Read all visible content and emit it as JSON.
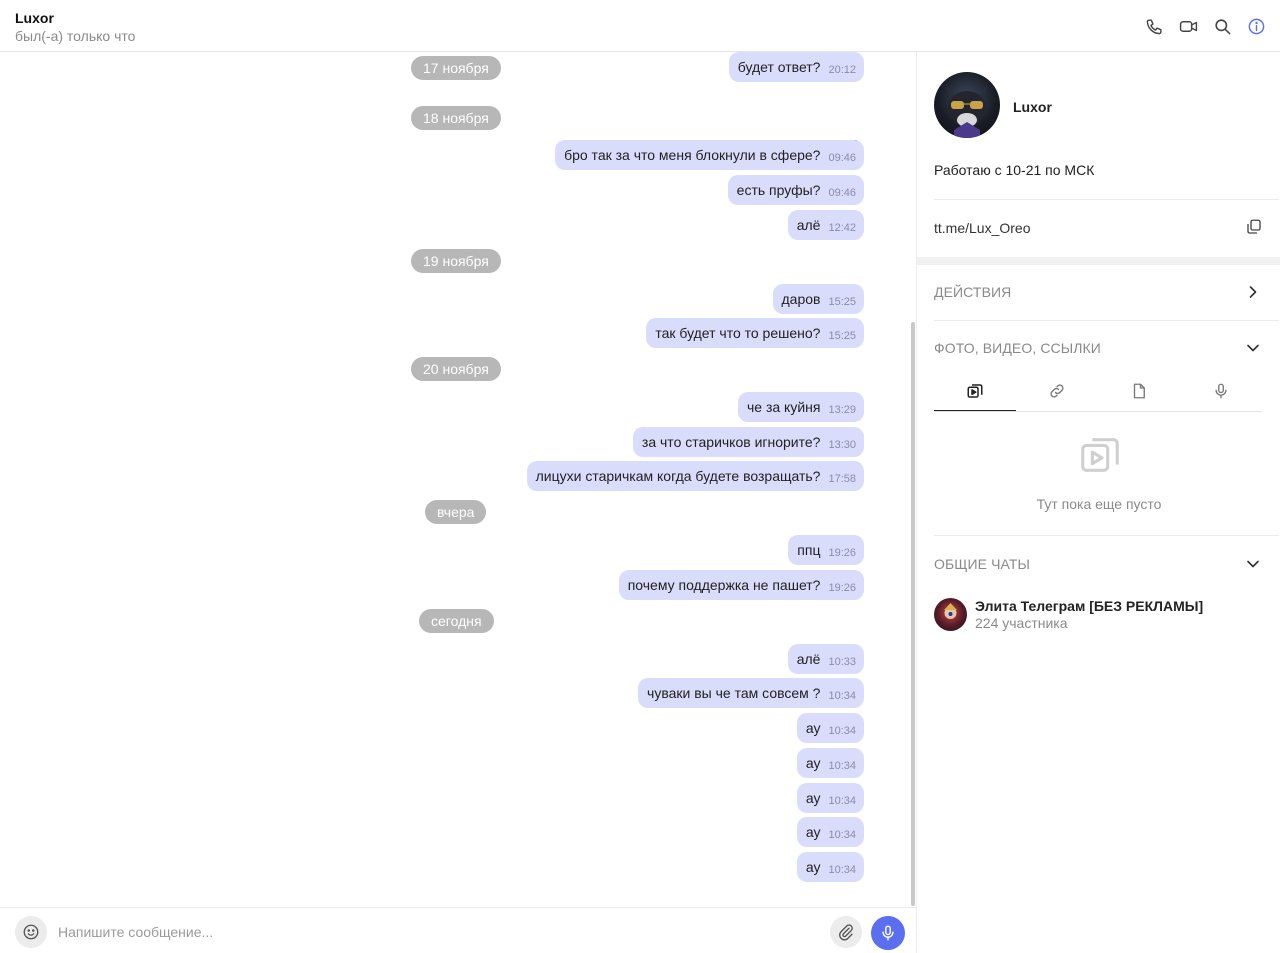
{
  "header": {
    "title": "Luxor",
    "status": "был(-а) только что",
    "icons": [
      "phone-icon",
      "video-icon",
      "search-icon",
      "info-icon"
    ]
  },
  "chat": {
    "dates": [
      "17 ноября",
      "18 ноября",
      "19 ноября",
      "20 ноября",
      "вчера",
      "сегодня"
    ],
    "messages": [
      {
        "text": "будет ответ?",
        "time": "20:12"
      },
      {
        "text": "бро так за что меня блокнули в сфере?",
        "time": "09:46"
      },
      {
        "text": "есть пруфы?",
        "time": "09:46"
      },
      {
        "text": "алё",
        "time": "12:42"
      },
      {
        "text": "даров",
        "time": "15:25"
      },
      {
        "text": "так будет что то решено?",
        "time": "15:25"
      },
      {
        "text": "че за куйня",
        "time": "13:29"
      },
      {
        "text": "за что старичков игнорите?",
        "time": "13:30"
      },
      {
        "text": "лицухи старичкам когда будете возращать?",
        "time": "17:58"
      },
      {
        "text": "ппц",
        "time": "19:26"
      },
      {
        "text": "почему поддержка не пашет?",
        "time": "19:26"
      },
      {
        "text": "алё",
        "time": "10:33"
      },
      {
        "text": "чуваки вы че там совсем ?",
        "time": "10:34"
      },
      {
        "text": "ау",
        "time": "10:34"
      },
      {
        "text": "ау",
        "time": "10:34"
      },
      {
        "text": "ау",
        "time": "10:34"
      },
      {
        "text": "ау",
        "time": "10:34"
      },
      {
        "text": "ау",
        "time": "10:34"
      }
    ]
  },
  "composer": {
    "placeholder": "Напишите сообщение..."
  },
  "sidebar": {
    "name": "Luxor",
    "bio": "Работаю с 10-21 по МСК",
    "link": "tt.me/Lux_Oreo",
    "actions_title": "ДЕЙСТВИЯ",
    "media_title": "ФОТО, ВИДЕО, ССЫЛКИ",
    "media_tabs": [
      "media-icon",
      "link-icon",
      "file-icon",
      "voice-icon"
    ],
    "empty_text": "Тут пока еще пусто",
    "common_title": "ОБЩИЕ ЧАТЫ",
    "common_chats": [
      {
        "name": "Элита Телеграм [БЕЗ РЕКЛАМЫ]",
        "members": "224 участника"
      }
    ]
  },
  "colors": {
    "bubble": "#d9dcfb",
    "accent": "#5b6ef0",
    "date_pill": "#b7b7b7"
  }
}
